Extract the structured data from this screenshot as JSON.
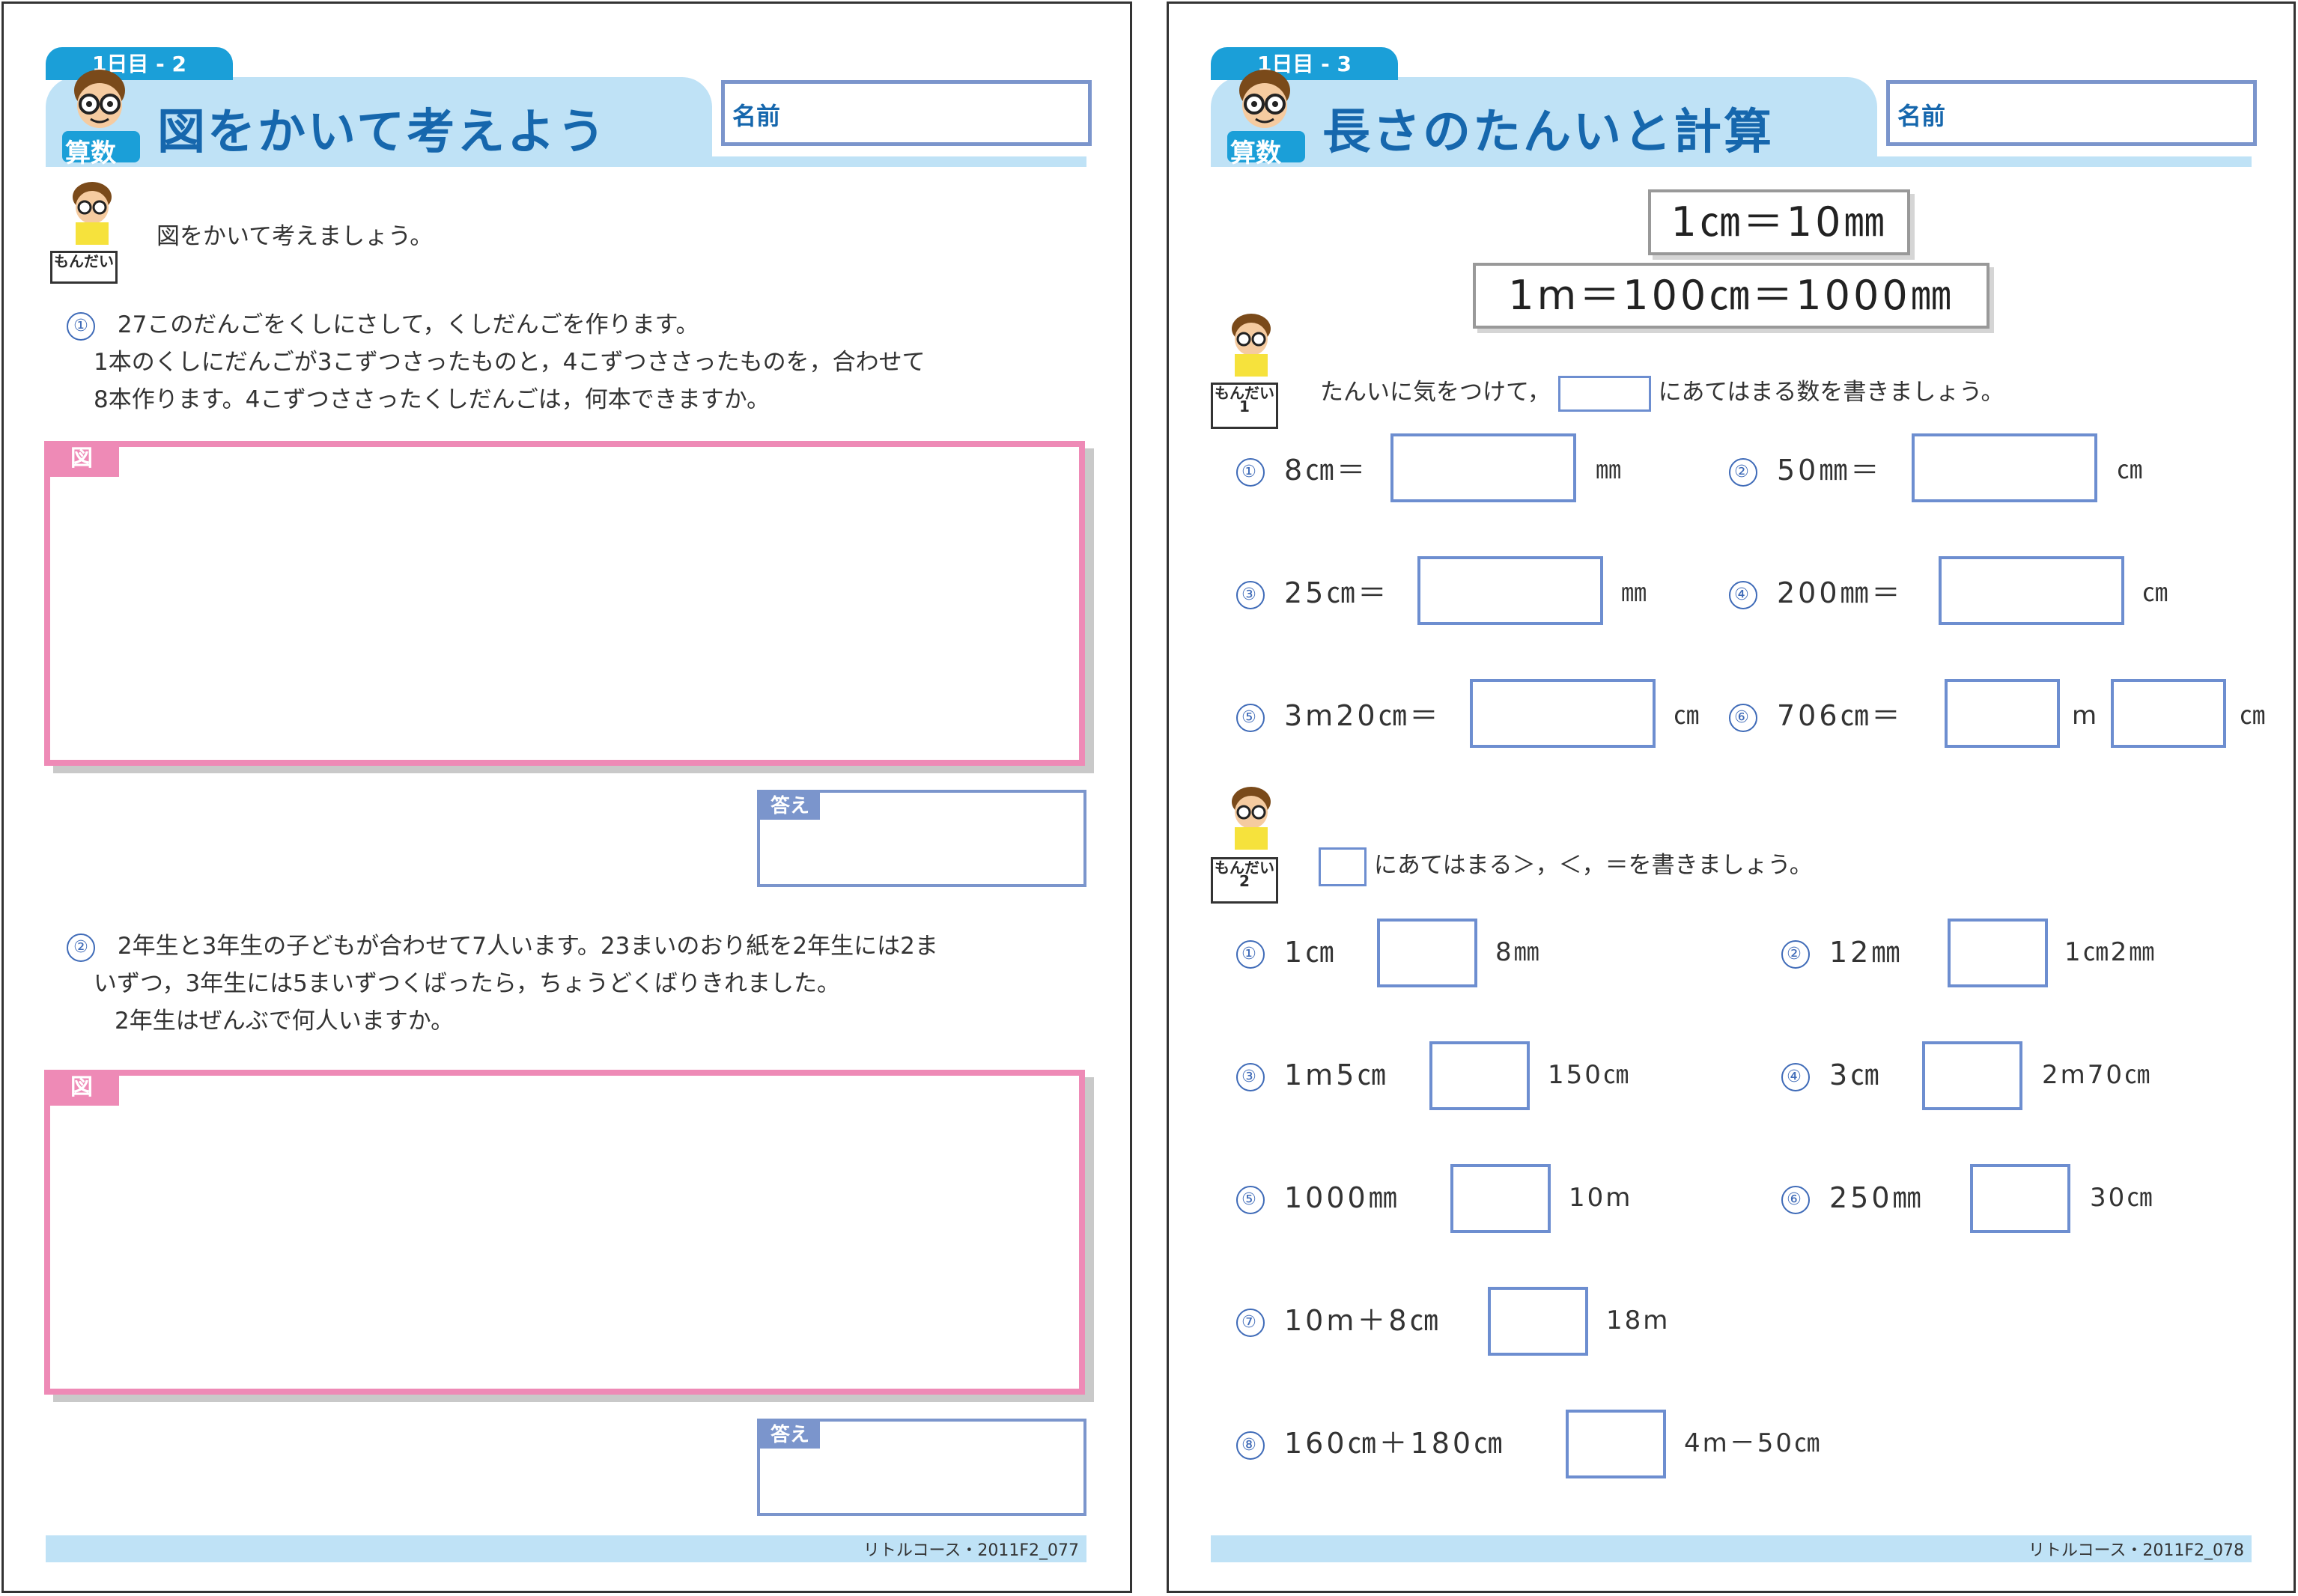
{
  "colors": {
    "accent_blue": "#1b9fd8",
    "title_blue": "#1667ad",
    "band": "#bfe2f6",
    "zu_pink": "#ee8ab6",
    "box_blue": "#6d8ed0"
  },
  "page1": {
    "tag": "1日目 - 2",
    "title": "図をかいて考えよう",
    "name_label": "名前",
    "logo_text": "算数",
    "problem_label": "もんだい",
    "instruction": "図をかいて考えましょう。",
    "q1": {
      "num": "①",
      "line1": "27このだんごをくしにさして，くしだんごを作ります。",
      "line2": "1本のくしにだんごが3こずつさったものと，4こずつささったものを，合わせて",
      "line3": "8本作ります。4こずつささったくしだんごは，何本できますか。"
    },
    "q2": {
      "num": "②",
      "line1": "2年生と3年生の子どもが合わせて7人います。23まいのおり紙を2年生には2ま",
      "line2": "いずつ，3年生には5まいずつくばったら，ちょうどくばりきれました。",
      "line3": "2年生はぜんぶで何人いますか。"
    },
    "zu_label": "図",
    "answer_label": "答え",
    "footer": "リトルコース・2011F2_077"
  },
  "page2": {
    "tag": "1日目 - 3",
    "title": "長さのたんいと計算",
    "name_label": "名前",
    "logo_text": "算数",
    "formula1": "1㎝＝10㎜",
    "formula2": "1m＝100㎝＝1000㎜",
    "problem1_label": "もんだい",
    "problem1_num": "1",
    "instruction1_a": "たんいに気をつけて，",
    "instruction1_b": "にあてはまる数を書きましょう。",
    "set1": [
      {
        "num": "①",
        "expr": "8㎝＝",
        "unit": "㎜"
      },
      {
        "num": "②",
        "expr": "50㎜＝",
        "unit": "㎝"
      },
      {
        "num": "③",
        "expr": "25㎝＝",
        "unit": "㎜"
      },
      {
        "num": "④",
        "expr": "200㎜＝",
        "unit": "㎝"
      },
      {
        "num": "⑤",
        "expr": "3m20㎝＝",
        "unit": "㎝"
      },
      {
        "num": "⑥",
        "expr": "706㎝＝",
        "unit": "m",
        "unit2": "㎝"
      }
    ],
    "problem2_label": "もんだい",
    "problem2_num": "2",
    "instruction2": "にあてはまる＞，＜，＝を書きましょう。",
    "set2": [
      {
        "num": "①",
        "left": "1㎝",
        "right": "8㎜"
      },
      {
        "num": "②",
        "left": "12㎜",
        "right": "1㎝2㎜"
      },
      {
        "num": "③",
        "left": "1m5㎝",
        "right": "150㎝"
      },
      {
        "num": "④",
        "left": "3㎝",
        "right": "2m70㎝"
      },
      {
        "num": "⑤",
        "left": "1000㎜",
        "right": "10m"
      },
      {
        "num": "⑥",
        "left": "250㎜",
        "right": "30㎝"
      },
      {
        "num": "⑦",
        "left": "10m＋8㎝",
        "right": "18m"
      },
      {
        "num": "⑧",
        "left": "160㎝＋180㎝",
        "right": "4m－50㎝"
      }
    ],
    "footer": "リトルコース・2011F2_078"
  }
}
